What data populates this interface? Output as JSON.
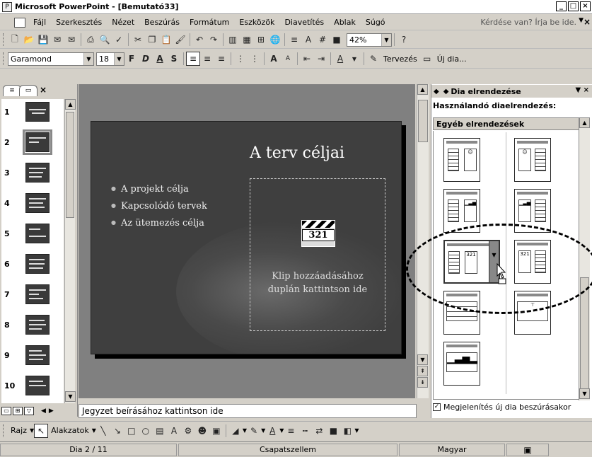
{
  "window": {
    "title": "Microsoft PowerPoint - [Bemutató33]"
  },
  "menu": {
    "items": [
      "Fájl",
      "Szerkesztés",
      "Nézet",
      "Beszúrás",
      "Formátum",
      "Eszközök",
      "Diavetítés",
      "Ablak",
      "Súgó"
    ],
    "help_placeholder": "Kérdése van? Írja be ide."
  },
  "standard_toolbar": {
    "zoom": "42%"
  },
  "format_toolbar": {
    "font": "Garamond",
    "size": "18",
    "bold": "F",
    "italic": "D",
    "underline": "A",
    "shadow": "S",
    "design_label": "Tervezés",
    "new_slide_label": "Új dia..."
  },
  "slides": {
    "numbers": [
      "1",
      "2",
      "3",
      "4",
      "5",
      "6",
      "7",
      "8",
      "9",
      "10"
    ],
    "selected_index": 1
  },
  "slide": {
    "title": "A terv céljai",
    "bullets": [
      "A projekt célja",
      "Kapcsolódó tervek",
      "Az ütemezés célja"
    ],
    "clip_icon_text": "321",
    "clip_line1": "Klip hozzáadásához",
    "clip_line2": "duplán kattintson ide"
  },
  "notes": {
    "placeholder": "Jegyzet beírásához kattintson ide"
  },
  "taskpane": {
    "title": "Dia elrendezése",
    "subtitle": "Használandó diaelrendezés:",
    "group": "Egyéb elrendezések",
    "checkbox_label": "Megjelenítés új dia beszúrásakor",
    "checkbox_checked": true
  },
  "drawing_toolbar": {
    "draw_label": "Rajz",
    "autoshapes_label": "Alakzatok"
  },
  "status": {
    "slide": "Dia 2 / 11",
    "design": "Csapatszellem",
    "language": "Magyar"
  }
}
